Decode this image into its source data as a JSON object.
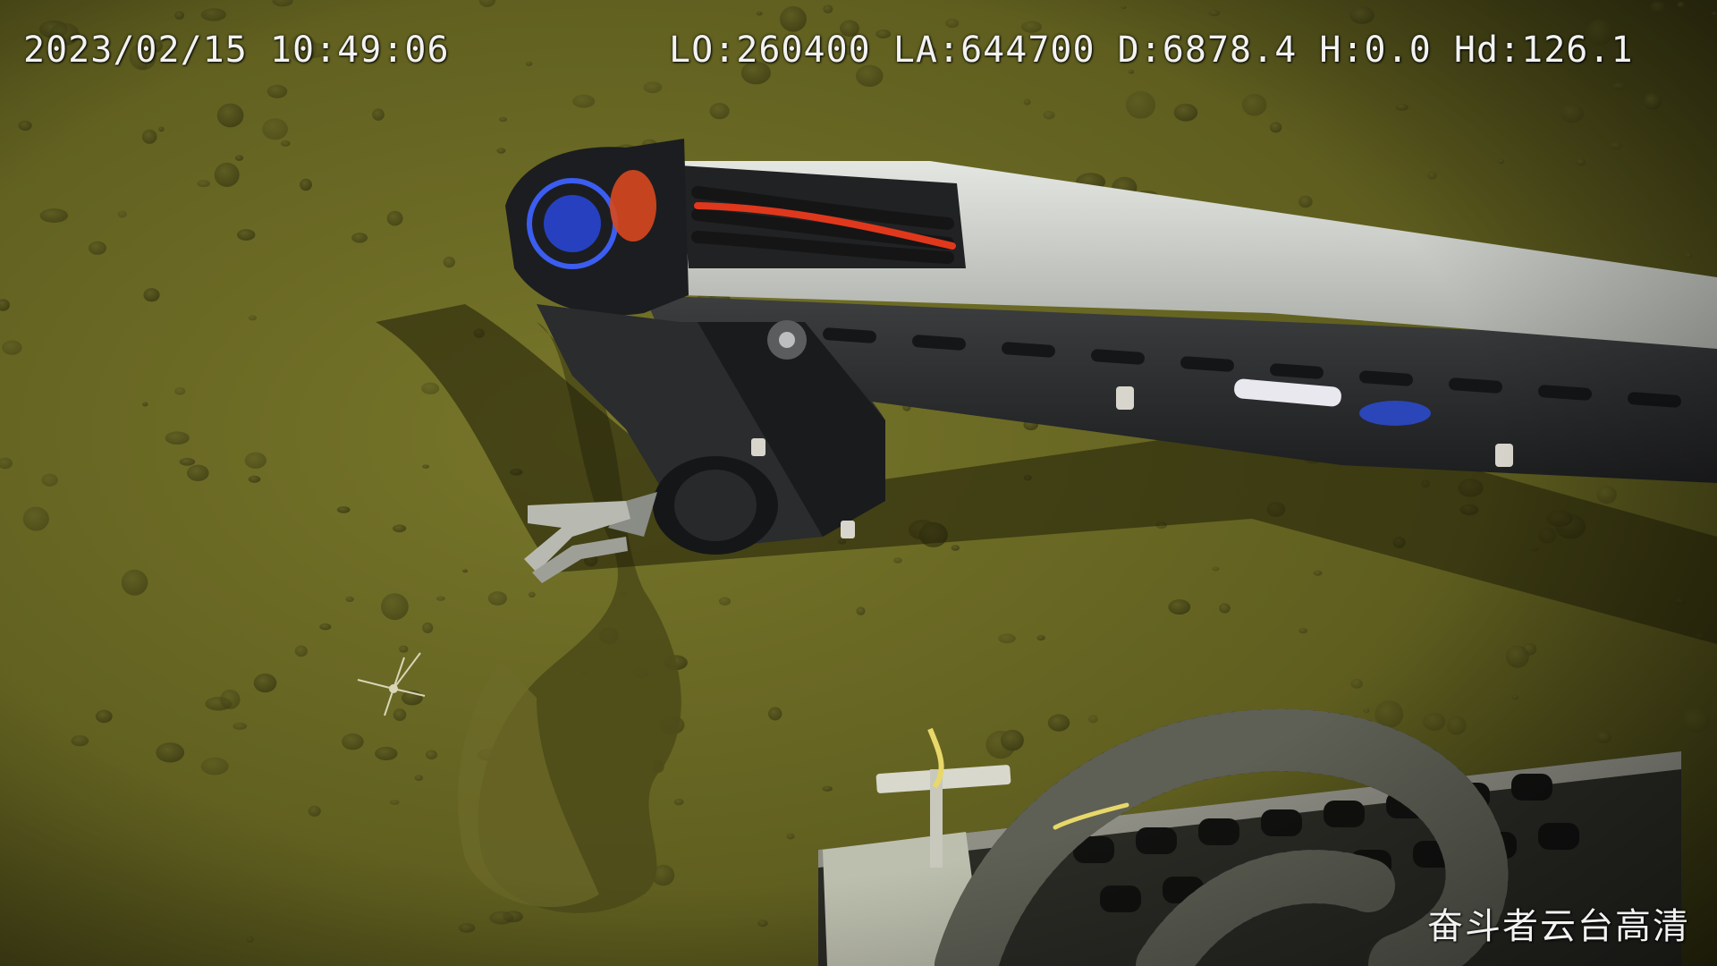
{
  "overlay": {
    "datetime": "2023/02/15 10:49:06",
    "telemetry": "LO:260400 LA:644700 D:6878.4 H:0.0 Hd:126.1",
    "camera_label": "奋斗者云台高清"
  },
  "scene": {
    "subject": "robotic manipulator arm with gripper over seafloor sediment",
    "colors": {
      "seafloor": "#6b6a24",
      "seafloor_dark": "#2d2c0e",
      "arm": "#c9ccc6",
      "arm_dark": "#2a2c2e",
      "cable_red": "#e0381c"
    }
  }
}
